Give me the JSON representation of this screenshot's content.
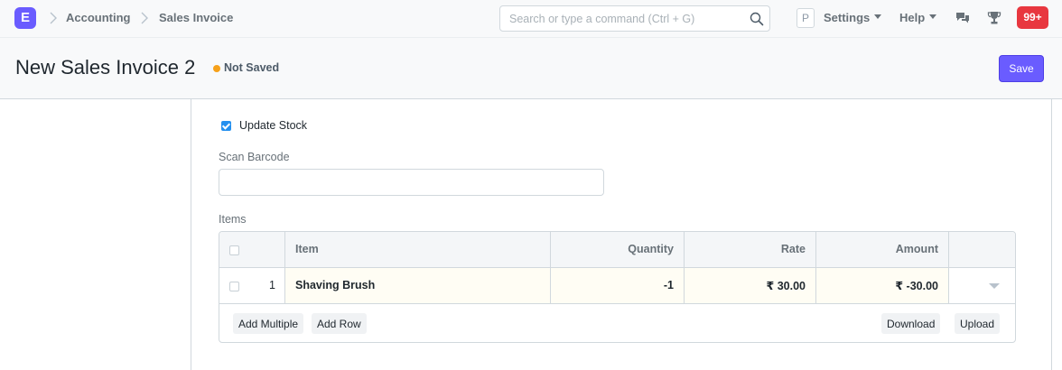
{
  "navbar": {
    "logo_letter": "E",
    "breadcrumbs": [
      "Accounting",
      "Sales Invoice"
    ],
    "search_placeholder": "Search or type a command (Ctrl + G)",
    "avatar_letter": "P",
    "settings_label": "Settings",
    "help_label": "Help",
    "notification_count": "99+"
  },
  "page": {
    "title": "New Sales Invoice 2",
    "status": "Not Saved",
    "save_label": "Save"
  },
  "form": {
    "update_stock_label": "Update Stock",
    "update_stock_checked": true,
    "scan_barcode_label": "Scan Barcode",
    "scan_barcode_value": "",
    "items_label": "Items"
  },
  "items_table": {
    "columns": [
      "Item",
      "Quantity",
      "Rate",
      "Amount"
    ],
    "rows": [
      {
        "idx": "1",
        "item": "Shaving Brush",
        "quantity": "-1",
        "rate": "₹ 30.00",
        "amount": "₹ -30.00"
      }
    ],
    "buttons": {
      "add_multiple": "Add Multiple",
      "add_row": "Add Row",
      "download": "Download",
      "upload": "Upload"
    }
  },
  "colors": {
    "brand": "#6a5cff",
    "status_dot": "#f6a11a",
    "notification": "#e8373f",
    "checkbox": "#2490ef"
  }
}
